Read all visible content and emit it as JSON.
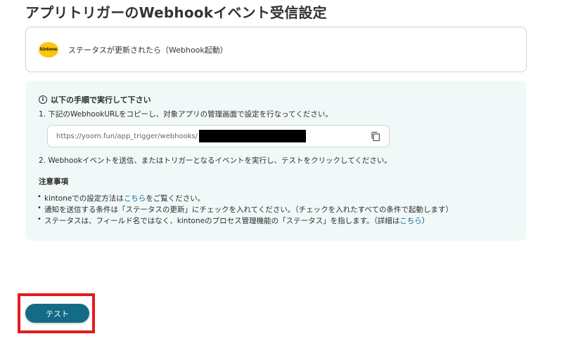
{
  "page": {
    "title": "アプリトリガーのWebhookイベント受信設定"
  },
  "trigger": {
    "app_logo_text": "kintone",
    "label": "ステータスが更新されたら（Webhook起動）",
    "brand_color": "#ffc20e"
  },
  "instructions": {
    "heading": "以下の手順で実行して下さい",
    "heading_icon": "info-icon",
    "step1": "1. 下記のWebhookURLをコピーし、対象アプリの管理画面で設定を行なってください。",
    "webhook_url_prefix": "https://yoom.fun/app_trigger/webhooks/",
    "copy_icon": "copy-icon",
    "step2": "2. Webhookイベントを送信、またはトリガーとなるイベントを実行し、テストをクリックしてください。"
  },
  "notes": {
    "heading": "注意事項",
    "note1_before": "kintoneでの設定方法は",
    "note1_link": "こちら",
    "note1_after": "をご覧ください。",
    "note2": "通知を送信する条件は「ステータスの更新」にチェックを入れてください。（チェックを入れたすべての条件で起動します）",
    "note3_before": "ステータスは、フィールド名ではなく、kintoneのプロセス管理機能の「ステータス」を指します。（詳細は",
    "note3_link": "こちら",
    "note3_after": "）"
  },
  "actions": {
    "test_label": "テスト",
    "primary_color": "#136b85",
    "highlight_color": "#e31b1b"
  }
}
